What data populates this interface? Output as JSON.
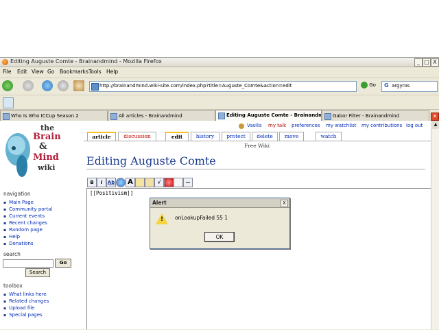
{
  "window": {
    "title": "Editing Auguste Comte - Brainandmind - Mozilla Firefox",
    "minimize": "_",
    "maximize": "□",
    "close": "X"
  },
  "menu": [
    "File",
    "Edit",
    "View",
    "Go",
    "Bookmarks",
    "Tools",
    "Help"
  ],
  "nav": {
    "url": "http://brainandmind.wiki-site.com/index.php?title=Auguste_Comte&action=edit",
    "go_label": "Go",
    "search_value": "argyros"
  },
  "tabs": [
    {
      "label": "Who Is Who ICCup Season 2"
    },
    {
      "label": "All articles - Brainandmind"
    },
    {
      "label": "Editing Auguste Comte - Brainandmi..."
    },
    {
      "label": "Gabor Filter - Brainandmind"
    }
  ],
  "user_links": [
    "Vasilis",
    "my talk",
    "preferences",
    "my watchlist",
    "my contributions",
    "log out"
  ],
  "page_tabs": [
    "article",
    "discussion",
    "edit",
    "history",
    "protect",
    "delete",
    "move",
    "watch"
  ],
  "site_sub": "Free Wiki",
  "page_title": "Editing Auguste Comte",
  "logo": {
    "line1": "the",
    "line2": "Brain",
    "line3": "&",
    "line4": "Mind",
    "line5": "wiki"
  },
  "sidebar": {
    "navigation_heading": "navigation",
    "navigation_items": [
      "Main Page",
      "Community portal",
      "Current events",
      "Recent changes",
      "Random page",
      "Help",
      "Donations"
    ],
    "search_heading": "search",
    "search_go": "Go",
    "search_button": "Search",
    "toolbox_heading": "toolbox",
    "toolbox_items": [
      "What links here",
      "Related changes",
      "Upload file",
      "Special pages"
    ]
  },
  "toolbar": [
    "B",
    "I",
    "Ab",
    "A",
    "√",
    "—"
  ],
  "editor": {
    "text": "[[Positivism]]"
  },
  "alert": {
    "title": "Alert",
    "close": "X",
    "message": "onLookupFailed 55 1",
    "ok_label": "OK"
  },
  "colors": {
    "link": "#002bb8",
    "accent_tab": "#fabd23",
    "title_blue": "#1a3a8c"
  }
}
